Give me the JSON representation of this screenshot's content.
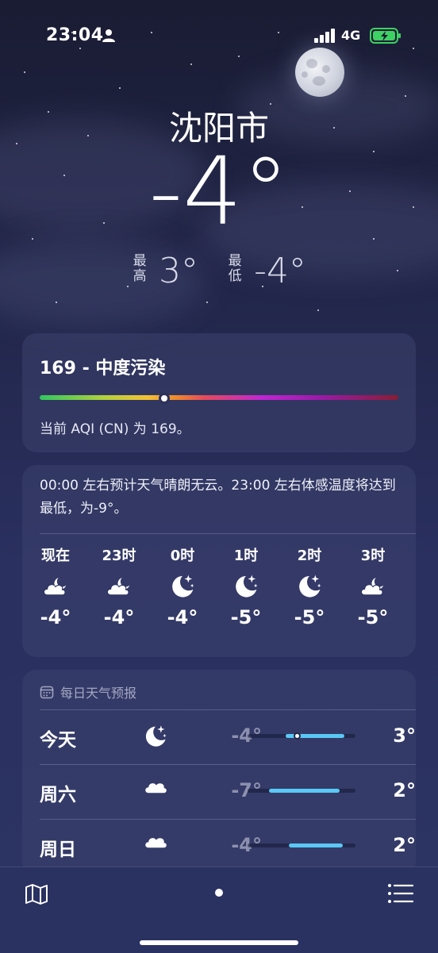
{
  "status_bar": {
    "time": "23:04",
    "network": "4G",
    "icons": [
      "person-icon",
      "signal-icon",
      "battery-charging-icon"
    ]
  },
  "location": {
    "city": "沈阳市",
    "current_temp": "-4°",
    "high_label": "最高",
    "high": "3°",
    "low_label": "最低",
    "low": "-4°"
  },
  "aqi": {
    "title": "169 - 中度污染",
    "description": "当前 AQI (CN) 为 169。",
    "indicator_fraction": 0.34
  },
  "hourly": {
    "summary": "00:00 左右预计天气晴朗无云。23:00 左右体感温度将达到最低，为-9°。",
    "items": [
      {
        "label": "现在",
        "icon": "partly-cloudy-night-icon",
        "temp": "-4°"
      },
      {
        "label": "23时",
        "icon": "partly-cloudy-night-icon",
        "temp": "-4°"
      },
      {
        "label": "0时",
        "icon": "clear-night-icon",
        "temp": "-4°"
      },
      {
        "label": "1时",
        "icon": "clear-night-icon",
        "temp": "-5°"
      },
      {
        "label": "2时",
        "icon": "clear-night-icon",
        "temp": "-5°"
      },
      {
        "label": "3时",
        "icon": "partly-cloudy-night-icon",
        "temp": "-5°"
      }
    ]
  },
  "daily": {
    "header": "每日天气预报",
    "rows": [
      {
        "day": "今天",
        "icon": "clear-night-icon",
        "low": "-4°",
        "high": "3°",
        "range_start": 0.35,
        "range_end": 0.9,
        "current_pos": 0.45
      },
      {
        "day": "周六",
        "icon": "cloudy-icon",
        "low": "-7°",
        "high": "2°",
        "range_start": 0.2,
        "range_end": 0.85
      },
      {
        "day": "周日",
        "icon": "cloudy-icon",
        "low": "-4°",
        "high": "2°",
        "range_start": 0.38,
        "range_end": 0.88
      }
    ]
  },
  "colors": {
    "temp_bar": "#5ac8f5",
    "background_top": "#1a1c33",
    "background_bottom": "#2c3564"
  }
}
